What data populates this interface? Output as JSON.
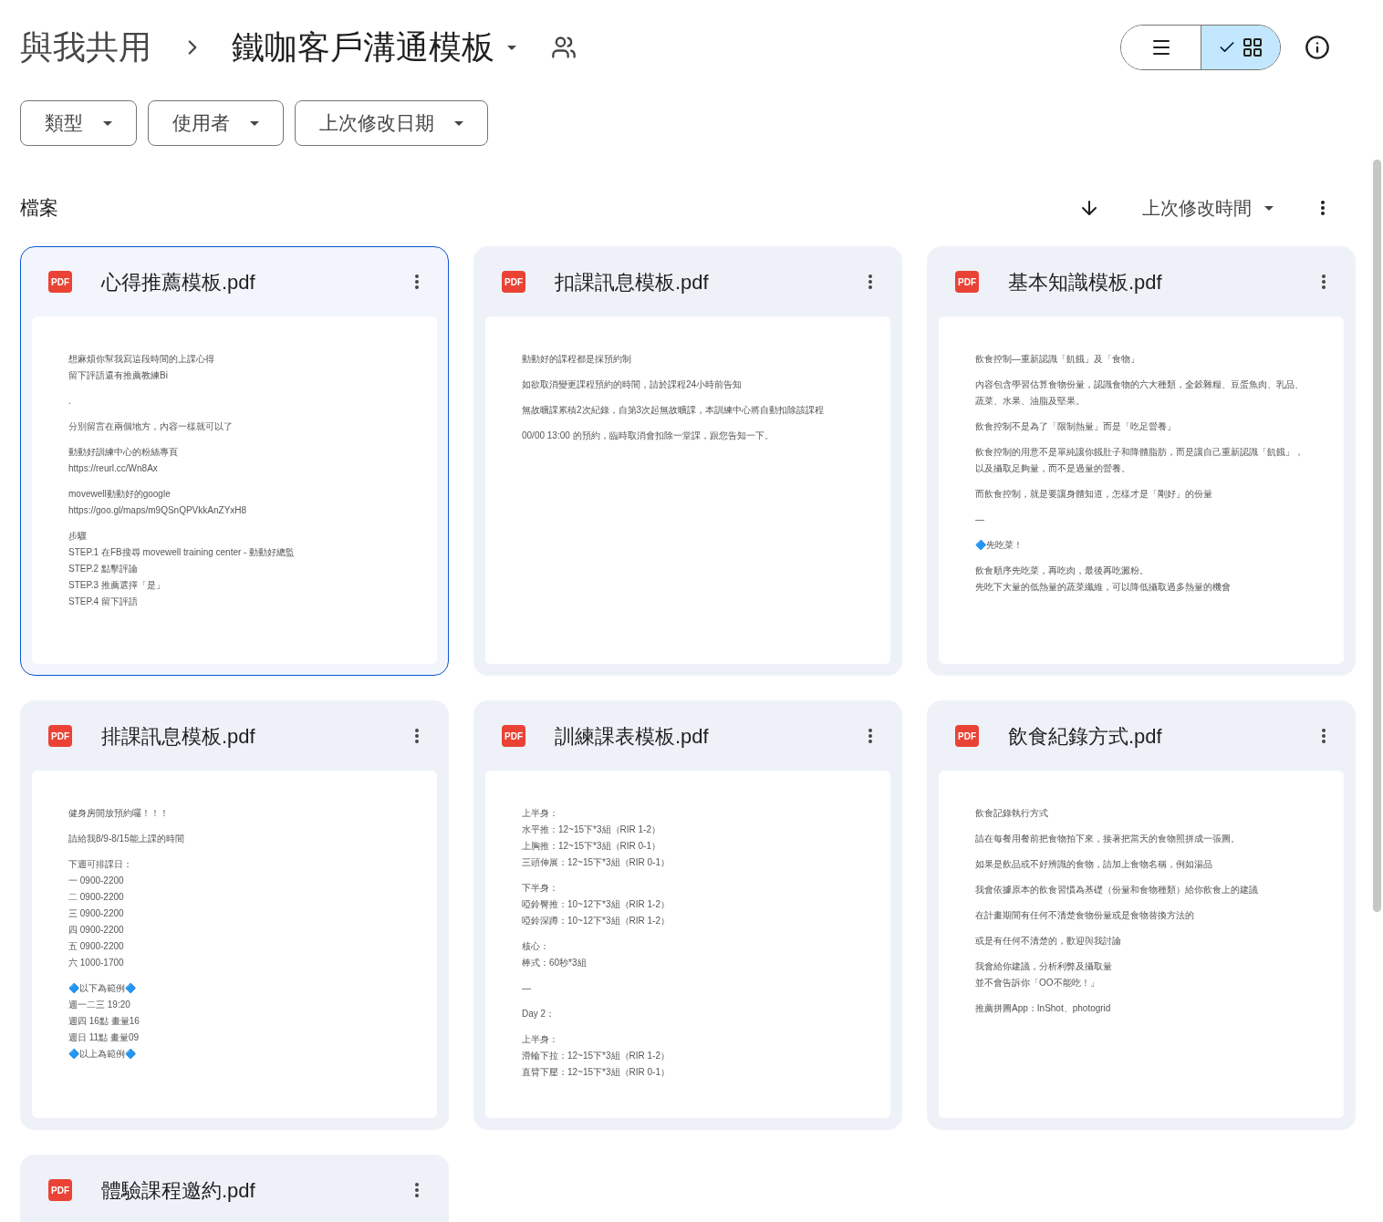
{
  "breadcrumb": {
    "parent": "與我共用",
    "current": "鐵咖客戶溝通模板"
  },
  "view_toggle": [
    {
      "kind": "list",
      "selected": false
    },
    {
      "kind": "grid",
      "selected": true
    }
  ],
  "filters": [
    "類型",
    "使用者",
    "上次修改日期"
  ],
  "section": {
    "title": "檔案",
    "sort_label": "上次修改時間"
  },
  "files": [
    {
      "name": "心得推薦模板.pdf",
      "badge": "PDF",
      "selected": true,
      "preview": [
        [
          "想麻煩你幫我寫這段時間的上課心得",
          "留下評語還有推薦教練Bi"
        ],
        [
          "."
        ],
        [
          "分別留言在兩個地方，內容一樣就可以了"
        ],
        [
          "動動好訓練中心的粉絲專頁",
          "https://reurl.cc/Wn8Ax"
        ],
        [
          "movewell動動好的google",
          "https://goo.gl/maps/m9QSnQPVkkAnZYxH8"
        ],
        [
          "步驟",
          "STEP.1 在FB搜尋 movewell training center - 動動好總監",
          "STEP.2 點擊評論",
          "STEP.3 推薦選擇「是」",
          "STEP.4 留下評語"
        ]
      ]
    },
    {
      "name": "扣課訊息模板.pdf",
      "badge": "PDF",
      "selected": false,
      "preview": [
        [
          "動動好的課程都是採預約制"
        ],
        [
          "如欲取消變更課程預約的時間，請於課程24小時前告知"
        ],
        [
          "無故曠課累積2次紀錄，自第3次起無故曠課，本訓練中心將自動扣除該課程"
        ],
        [
          "00/00 13:00 的預約，臨時取消會扣除一堂課，跟您告知一下。"
        ]
      ]
    },
    {
      "name": "基本知識模板.pdf",
      "badge": "PDF",
      "selected": false,
      "preview": [
        [
          "飲食控制—重新認識「飢餓」及「食物」"
        ],
        [
          "內容包含學習估算食物份量，認識食物的六大種類，全穀雜糧、豆蛋魚肉、乳品、",
          "蔬菜、水果、油脂及堅果。"
        ],
        [
          "飲食控制不是為了「限制熱量」而是「吃足營養」"
        ],
        [
          "飲食控制的用意不是單純讓你餓肚子和降體脂肪，而是讓自己重新認識「飢餓」，",
          "以及攝取足夠量，而不是過量的營養。"
        ],
        [
          "而飲食控制，就是要讓身體知道，怎樣才是「剛好」的份量"
        ],
        [
          "—"
        ],
        [
          "🔷先吃菜！"
        ],
        [
          "飲食順序先吃菜，再吃肉，最後再吃澱粉。",
          "先吃下大量的低熱量的蔬菜纖維，可以降低攝取過多熱量的機會"
        ]
      ]
    },
    {
      "name": "排課訊息模板.pdf",
      "badge": "PDF",
      "selected": false,
      "preview": [
        [
          "健身房開放預約囉！！！"
        ],
        [
          "請給我8/9-8/15能上課的時間"
        ],
        [
          "下週可排課日：",
          "一 0900-2200",
          "二 0900-2200",
          "三 0900-2200",
          "四 0900-2200",
          "五 0900-2200",
          "六 1000-1700"
        ],
        [
          "🔷以下為範例🔷",
          "週一二三 19:20",
          "週四 16點 畫量16",
          "週日 11點 畫量09",
          "🔷以上為範例🔷"
        ]
      ]
    },
    {
      "name": "訓練課表模板.pdf",
      "badge": "PDF",
      "selected": false,
      "preview": [
        [
          "上半身：",
          "水平推：12~15下*3組（RIR 1-2）",
          "上胸推：12~15下*3組（RIR 0-1）",
          "三頭伸展：12~15下*3組（RIR 0-1）"
        ],
        [
          "下半身：",
          "啞鈴臀推：10~12下*3組（RIR 1-2）",
          "啞鈴深蹲：10~12下*3組（RIR 1-2）"
        ],
        [
          "核心：",
          "棒式：60秒*3組"
        ],
        [
          "—"
        ],
        [
          "Day 2："
        ],
        [
          "上半身：",
          "滑輪下拉：12~15下*3組（RIR 1-2）",
          "直臂下壓：12~15下*3組（RIR 0-1）"
        ]
      ]
    },
    {
      "name": "飲食紀錄方式.pdf",
      "badge": "PDF",
      "selected": false,
      "preview": [
        [
          "飲食記錄執行方式"
        ],
        [
          "請在每餐用餐前把食物拍下來，接著把當天的食物照拼成一張圖。"
        ],
        [
          "如果是飲品或不好辨識的食物，請加上食物名稱，例如湯品"
        ],
        [
          "我會依據原本的飲食習慣為基礎（份量和食物種類）給你飲食上的建議"
        ],
        [
          "在計畫期間有任何不清楚食物份量或是食物替換方法的"
        ],
        [
          "或是有任何不清楚的，歡迎與我討論"
        ],
        [
          "我會給你建議，分析利弊及攝取量",
          "並不會告訴你「OO不能吃！」"
        ],
        [
          "推薦拼圖App：InShot、photogrid"
        ]
      ]
    },
    {
      "name": "體驗課程邀約.pdf",
      "badge": "PDF",
      "selected": false
    }
  ]
}
